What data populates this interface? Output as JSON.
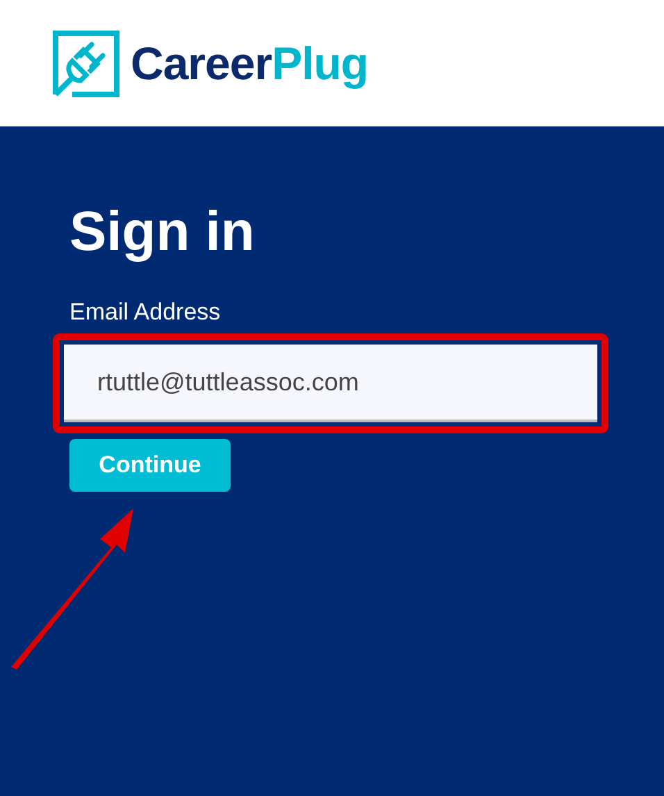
{
  "logo": {
    "part_1": "Career",
    "part_2": "Plug"
  },
  "title": "Sign in",
  "email": {
    "label": "Email Address",
    "value": "rtuttle@tuttleassoc.com",
    "highlighted": true
  },
  "buttons": [
    "Continue"
  ]
}
